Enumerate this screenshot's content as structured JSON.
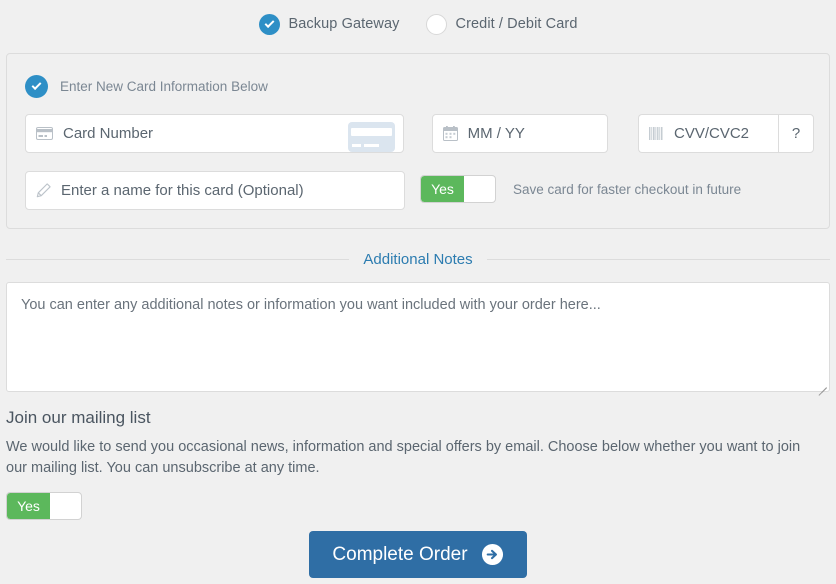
{
  "gateway": {
    "options": [
      {
        "label": "Backup Gateway",
        "selected": true
      },
      {
        "label": "Credit / Debit Card",
        "selected": false
      }
    ]
  },
  "card_panel": {
    "heading": "Enter New Card Information Below",
    "heading_selected": true,
    "fields": {
      "card_number_placeholder": "Card Number",
      "card_number_icon": "credit-card-icon",
      "expiry_placeholder": "MM / YY",
      "expiry_icon": "calendar-icon",
      "cvv_placeholder": "CVV/CVC2",
      "cvv_icon": "barcode-icon",
      "cvv_help_label": "?",
      "card_name_placeholder": "Enter a name for this card (Optional)",
      "card_name_icon": "pencil-icon"
    },
    "save_card": {
      "toggle_value": "Yes",
      "label": "Save card for faster checkout in future"
    }
  },
  "notes": {
    "title": "Additional Notes",
    "placeholder": "You can enter any additional notes or information you want included with your order here...",
    "value": ""
  },
  "mailing_list": {
    "title": "Join our mailing list",
    "description": "We would like to send you occasional news, information and special offers by email. Choose below whether you want to join our mailing list. You can unsubscribe at any time.",
    "toggle_value": "Yes"
  },
  "submit": {
    "label": "Complete Order",
    "icon": "arrow-circle-right-icon"
  },
  "colors": {
    "page_bg": "#f0f0f0",
    "accent_blue": "#2e8fc6",
    "link_blue": "#2c7cb0",
    "toggle_green": "#5cb85c",
    "cta_blue": "#2f6ea5",
    "border": "#dcdcdc"
  }
}
